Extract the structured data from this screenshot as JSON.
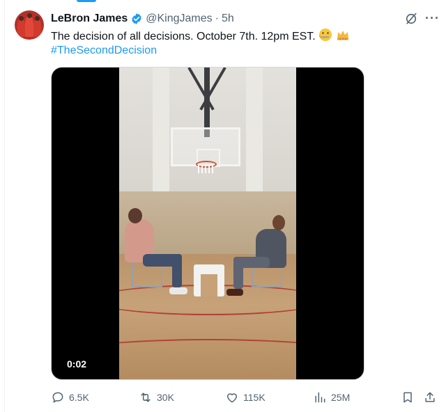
{
  "tweet": {
    "author_name": "LeBron James",
    "handle": "@KingJames",
    "separator": "·",
    "time": "5h",
    "text": "The decision of all decisions. October 7th. 12pm EST.",
    "hashtag": "#TheSecondDecision",
    "emojis": [
      "zipper-mouth-face",
      "crown"
    ]
  },
  "media": {
    "type": "video",
    "timer": "0:02"
  },
  "actions": {
    "replies": "6.5K",
    "reposts": "30K",
    "likes": "115K",
    "views": "25M"
  },
  "colors": {
    "accent": "#1d9bf0",
    "text": "#0f1419",
    "muted": "#536471"
  }
}
